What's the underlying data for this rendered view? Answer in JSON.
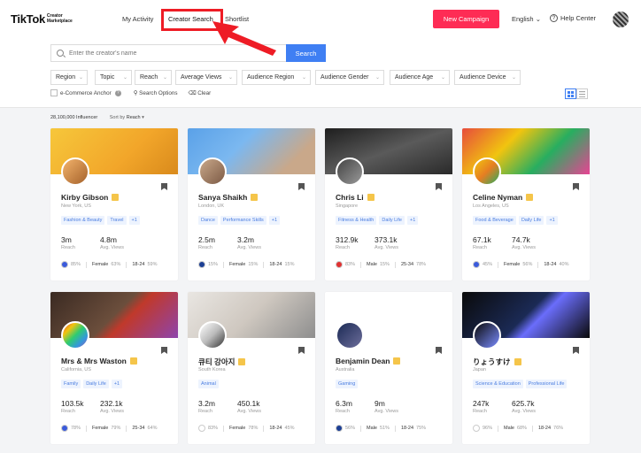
{
  "header": {
    "logo": "TikTok",
    "logo_sub_1": "Creator",
    "logo_sub_2": "Marketplace",
    "nav": [
      "My Activity",
      "Creator Search",
      "Shortlist"
    ],
    "new_campaign": "New Campaign",
    "language": "English",
    "help": "Help Center"
  },
  "search": {
    "placeholder": "Enter the creator's name",
    "button": "Search"
  },
  "filters": [
    "Region",
    "Topic",
    "Reach",
    "Average Views",
    "Audience Region",
    "Audience Gender",
    "Audience Age",
    "Audience Device"
  ],
  "options": {
    "ecommerce": "e-Commerce Anchor",
    "search_options": "Search Options",
    "clear": "Clear"
  },
  "result_count": "28,100,000 Influencer",
  "sort_by_label": "Sort by",
  "sort_by_value": "Reach",
  "stat_labels": {
    "reach": "Reach",
    "views": "Avg. Views"
  },
  "accent_color": "#fe2c55",
  "cards": [
    {
      "name": "Kirby Gibson",
      "location": "New York, US",
      "tags": [
        "Fashion & Beauty",
        "Travel",
        "+1"
      ],
      "reach": "3m",
      "views": "4.8m",
      "country_pct": "85%",
      "gender": "Female",
      "gender_pct": "63%",
      "age": "18-24",
      "age_pct": "59%"
    },
    {
      "name": "Sanya Shaikh",
      "location": "London, UK",
      "tags": [
        "Dance",
        "Performance Skills",
        "+1"
      ],
      "reach": "2.5m",
      "views": "3.2m",
      "country_pct": "15%",
      "gender": "Female",
      "gender_pct": "15%",
      "age": "18-24",
      "age_pct": "15%"
    },
    {
      "name": "Chris Li",
      "location": "Singapore",
      "tags": [
        "Fitness & Health",
        "Daily Life",
        "+1"
      ],
      "reach": "312.9k",
      "views": "373.1k",
      "country_pct": "83%",
      "gender": "Male",
      "gender_pct": "15%",
      "age": "25-34",
      "age_pct": "78%"
    },
    {
      "name": "Celine Nyman",
      "location": "Los Angeles, US",
      "tags": [
        "Food & Beverage",
        "Daily Life",
        "+1"
      ],
      "reach": "67.1k",
      "views": "74.7k",
      "country_pct": "45%",
      "gender": "Female",
      "gender_pct": "56%",
      "age": "18-24",
      "age_pct": "40%"
    },
    {
      "name": "Mrs & Mrs Waston",
      "location": "California, US",
      "tags": [
        "Family",
        "Daily Life",
        "+1"
      ],
      "reach": "103.5k",
      "views": "232.1k",
      "country_pct": "78%",
      "gender": "Female",
      "gender_pct": "79%",
      "age": "25-34",
      "age_pct": "64%"
    },
    {
      "name": "큐티 강아지",
      "location": "South Korea",
      "tags": [
        "Animal"
      ],
      "reach": "3.2m",
      "views": "450.1k",
      "country_pct": "83%",
      "gender": "Female",
      "gender_pct": "78%",
      "age": "18-24",
      "age_pct": "45%"
    },
    {
      "name": "Benjamin Dean",
      "location": "Australia",
      "tags": [
        "Gaming"
      ],
      "reach": "6.3m",
      "views": "9m",
      "country_pct": "56%",
      "gender": "Male",
      "gender_pct": "51%",
      "age": "18-24",
      "age_pct": "75%"
    },
    {
      "name": "りょうすけ",
      "location": "Japan",
      "tags": [
        "Science & Education",
        "Professional Life"
      ],
      "reach": "247k",
      "views": "625.7k",
      "country_pct": "96%",
      "gender": "Male",
      "gender_pct": "68%",
      "age": "18-24",
      "age_pct": "76%"
    }
  ]
}
